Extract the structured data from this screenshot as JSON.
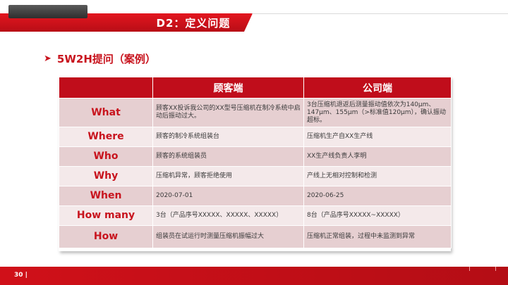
{
  "header": {
    "title": "D2：定义问题"
  },
  "subtitle": {
    "arrow_icon": "chevron-right-icon",
    "text": "5W2H提问（案例）"
  },
  "table": {
    "headers": [
      "",
      "顾客端",
      "公司端"
    ],
    "rows": [
      {
        "label": "What",
        "customer": "顾客XX投诉我公司的XX型号压缩机在制冷系统中启动后振动过大。",
        "company": "3台压缩机退返后测量振动值依次为140μm、147μm、155μm（>标准值120μm），确认振动超标。"
      },
      {
        "label": "Where",
        "customer": "顾客的制冷系统组装台",
        "company": "压缩机生产自XX生产线"
      },
      {
        "label": "Who",
        "customer": "顾客的系统组装员",
        "company": "XX生产线负责人李明"
      },
      {
        "label": "Why",
        "customer": "压缩机异常，顾客拒绝使用",
        "company": "产线上无相对控制和检测"
      },
      {
        "label": "When",
        "customer": "2020-07-01",
        "company": "2020-06-25"
      },
      {
        "label": "How many",
        "customer": "3台（产品序号XXXXX、XXXXX、XXXXX）",
        "company": "8台（产品序号XXXXX~XXXXX）"
      },
      {
        "label": "How",
        "customer": "组装员在试运行时测量压缩机振幅过大",
        "company": "压缩机正常组装，过程中未监测到异常"
      }
    ]
  },
  "footer": {
    "page_number": "30 |"
  },
  "colors": {
    "brand_red": "#c8141e",
    "header_cell": "#c00d1b",
    "row_dark": "#e6cfd1",
    "row_light": "#f4e9ea"
  }
}
